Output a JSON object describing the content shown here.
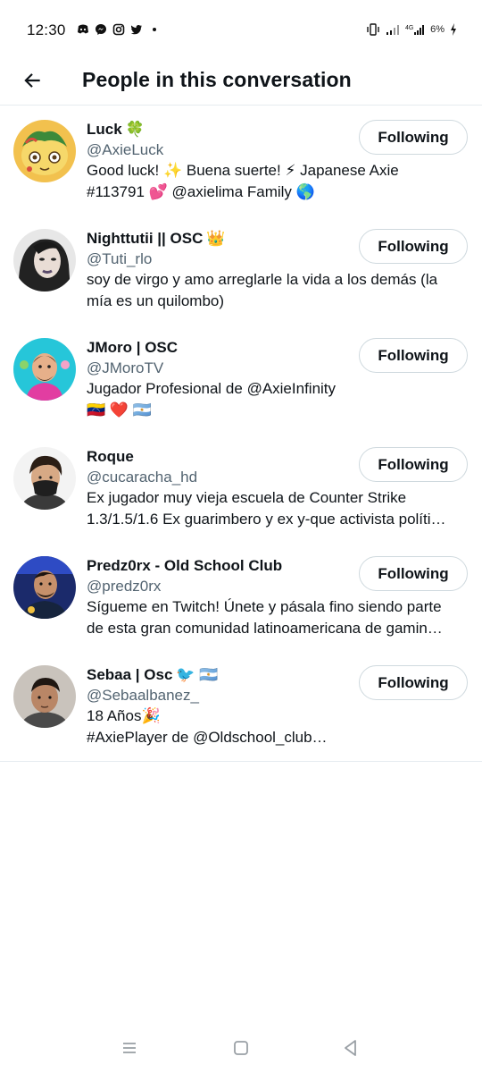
{
  "status_bar": {
    "time": "12:30",
    "battery": "6%",
    "left_icons": [
      "discord-icon",
      "messenger-icon",
      "instagram-icon",
      "twitter-icon",
      "dot-icon"
    ],
    "right_icons": [
      "vibrate-icon",
      "signal-icon",
      "4g-signal-icon",
      "charging-icon"
    ]
  },
  "header": {
    "title": "People in this conversation",
    "back_icon": "back-arrow-icon"
  },
  "people": [
    {
      "name": "Luck",
      "name_emoji": "🍀",
      "handle": "@AxieLuck",
      "bio": [
        "Good luck! ✨ Buena suerte! ⚡ Japanese Axie",
        "#113791 💕 @axielima Family 🌎"
      ],
      "button": "Following"
    },
    {
      "name": "Nighttutii || OSC",
      "name_emoji": "👑",
      "handle": "@Tuti_rlo",
      "bio": [
        "soy de virgo y amo arreglarle la vida a los demás (la",
        "mía es un quilombo)"
      ],
      "button": "Following"
    },
    {
      "name": "JMoro | OSC",
      "name_emoji": "",
      "handle": "@JMoroTV",
      "bio": [
        "Jugador Profesional de @AxieInfinity",
        "🇻🇪 ❤️ 🇦🇷"
      ],
      "button": "Following"
    },
    {
      "name": "Roque",
      "name_emoji": "",
      "handle": "@cucaracha_hd",
      "bio": [
        "Ex jugador muy vieja escuela de Counter Strike",
        "1.3/1.5/1.6 Ex guarimbero y ex y-que activista políti…"
      ],
      "button": "Following"
    },
    {
      "name": "Predz0rx - Old School Club",
      "name_emoji": "",
      "handle": "@predz0rx",
      "bio": [
        "Sígueme en Twitch! Únete y pásala fino siendo parte",
        "de esta gran comunidad latinoamericana de gamin…"
      ],
      "button": "Following"
    },
    {
      "name": "Sebaa | Osc",
      "name_emoji": "🐦 🇦🇷",
      "handle": "@Sebaalbanez_",
      "bio": [
        "18 Años🎉",
        "#AxiePlayer de @Oldschool_club…"
      ],
      "button": "Following"
    }
  ],
  "nav_bar": {
    "icons": [
      "menu-icon",
      "home-square-icon",
      "back-triangle-icon"
    ]
  },
  "colors": {
    "text_primary": "#0f1419",
    "text_secondary": "#536471",
    "divider": "#e6ecf0",
    "button_border": "#cfd9de"
  }
}
